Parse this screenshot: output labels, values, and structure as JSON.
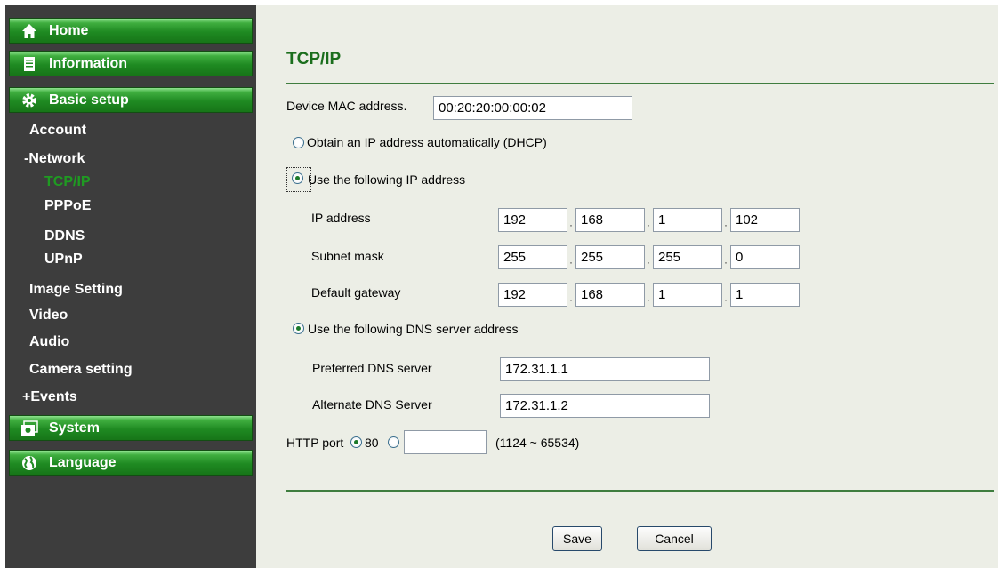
{
  "sidebar": {
    "home": "Home",
    "information": "Information",
    "basic_setup": "Basic setup",
    "items": {
      "account": "Account",
      "network": "-Network",
      "tcpip": "TCP/IP",
      "pppoe": "PPPoE",
      "ddns": "DDNS",
      "upnp": "UPnP",
      "image_setting": "Image Setting",
      "video": "Video",
      "audio": "Audio",
      "camera_setting": "Camera setting",
      "events": "+Events"
    },
    "system": "System",
    "language": "Language",
    "active_item": "TCP/IP",
    "colors": {
      "button_green": "#1f8a22",
      "active_text": "#1f9b22",
      "background": "#3d3d3d"
    }
  },
  "main": {
    "title": "TCP/IP",
    "mac": {
      "label": "Device MAC address.",
      "value": "00:20:20:00:00:02"
    },
    "dhcp_label": "Obtain an IP address automatically (DHCP)",
    "static_label": "Use the following IP address",
    "ip_mode_selected": "static",
    "ip": {
      "label": "IP address",
      "octets": [
        "192",
        "168",
        "1",
        "102"
      ]
    },
    "subnet": {
      "label": "Subnet mask",
      "octets": [
        "255",
        "255",
        "255",
        "0"
      ]
    },
    "gateway": {
      "label": "Default gateway",
      "octets": [
        "192",
        "168",
        "1",
        "1"
      ]
    },
    "dns_label": "Use the following DNS server address",
    "dns_preferred": {
      "label": "Preferred DNS server",
      "value": "172.31.1.1"
    },
    "dns_alternate": {
      "label": "Alternate DNS Server",
      "value": "172.31.1.2"
    },
    "http": {
      "label": "HTTP port",
      "default_port": "80",
      "custom_value": "",
      "range": "(1124 ~ 65534)",
      "selected": "80"
    },
    "save_label": "Save",
    "cancel_label": "Cancel",
    "colors": {
      "title": "#1b6e1d",
      "rule": "#3f7d3f",
      "background": "#eceee6"
    }
  }
}
